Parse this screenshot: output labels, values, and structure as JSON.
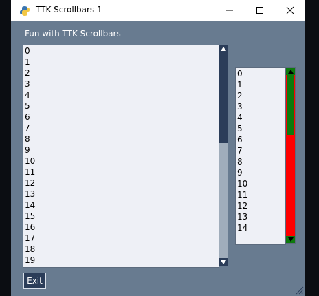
{
  "window": {
    "title": "TTK Scrollbars 1",
    "icon": "python-feather-icon"
  },
  "titlebar_buttons": [
    "minimize-icon",
    "maximize-icon",
    "close-icon"
  ],
  "heading": "Fun with TTK Scrollbars",
  "left_list": {
    "items": [
      "0",
      "1",
      "2",
      "3",
      "4",
      "5",
      "6",
      "7",
      "8",
      "9",
      "10",
      "11",
      "12",
      "13",
      "14",
      "15",
      "16",
      "17",
      "18",
      "19"
    ],
    "scroll_thumb_fraction": 0.44
  },
  "right_list": {
    "items": [
      "0",
      "1",
      "2",
      "3",
      "4",
      "5",
      "6",
      "7",
      "8",
      "9",
      "10",
      "11",
      "12",
      "13",
      "14"
    ],
    "scroll_thumb_fraction": 0.37,
    "colors": {
      "thumb": "#0d7a0d",
      "trough": "#ff0000",
      "arrow": "#0d7a0d"
    }
  },
  "colors": {
    "left_thumb": "#2b3d59",
    "left_trough": "#a0adbb"
  },
  "exit_button": {
    "label": "Exit"
  }
}
